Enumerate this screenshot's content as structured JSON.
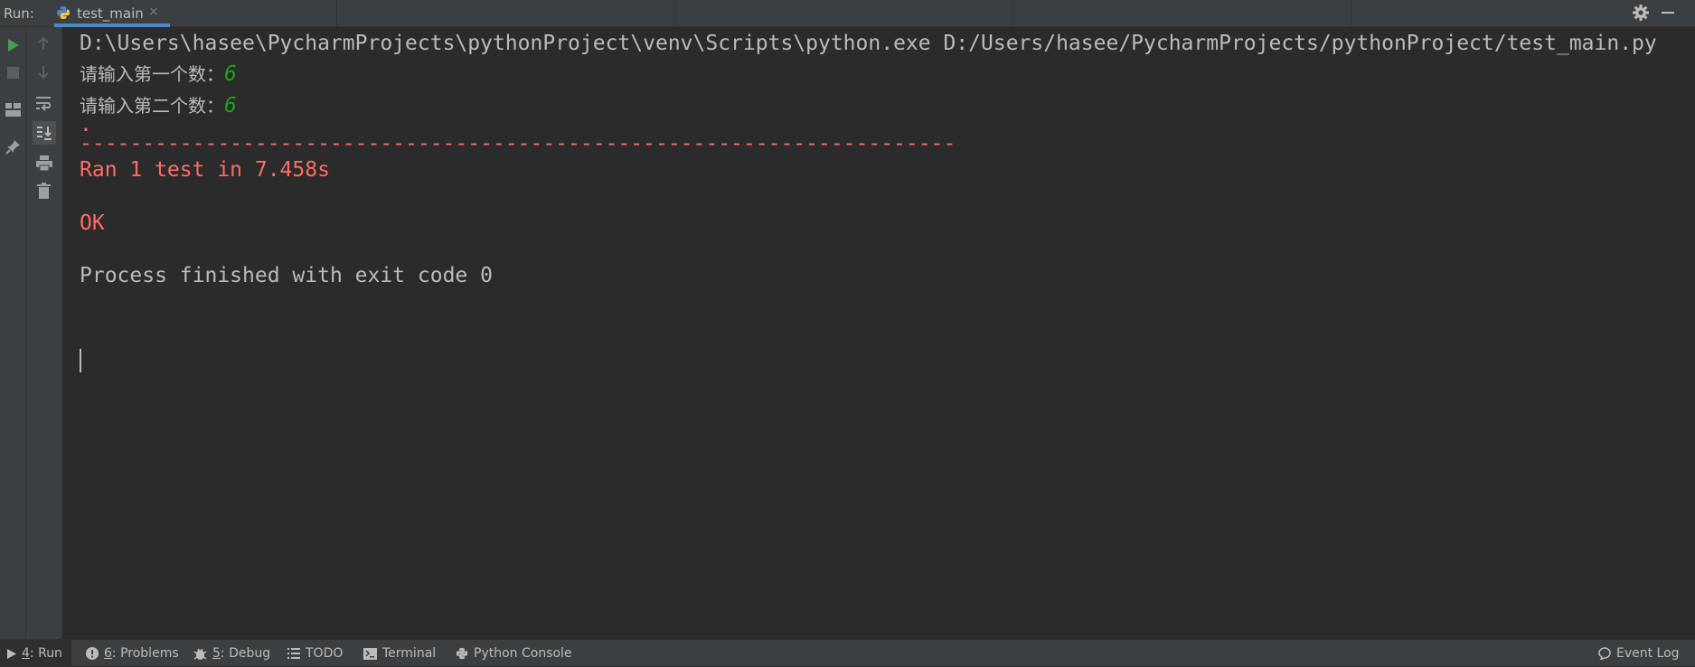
{
  "run_bar": {
    "label": "Run:",
    "tab": {
      "label": "test_main",
      "close": "×"
    }
  },
  "console": {
    "command": "D:\\Users\\hasee\\PycharmProjects\\pythonProject\\venv\\Scripts\\python.exe D:/Users/hasee/PycharmProjects/pythonProject/test_main.py",
    "prompt1": "请输入第一个数：",
    "input1": "6",
    "prompt2": "请输入第二个数：",
    "input2": "6",
    "dot": ".",
    "dashes": "----------------------------------------------------------------------",
    "ran": "Ran 1 test in 7.458s",
    "ok": "OK",
    "finished": "Process finished with exit code 0"
  },
  "bottom_bar": {
    "run": {
      "num": "4",
      "label": ": Run"
    },
    "problems": {
      "num": "6",
      "label": ": Problems"
    },
    "debug": {
      "num": "5",
      "label": ": Debug"
    },
    "todo": "TODO",
    "terminal": "Terminal",
    "python_console": "Python Console",
    "event_log": "Event Log"
  },
  "colors": {
    "background": "#2b2b2b",
    "toolbar": "#3c3f41",
    "accent": "#4a88c7",
    "error_red": "#ff6b68",
    "input_green": "#20a120",
    "run_green": "#499c54"
  },
  "icons": [
    "python-icon",
    "close-icon",
    "gear-icon",
    "minimize-icon",
    "rerun-icon",
    "stop-icon",
    "layout-icon",
    "pin-icon",
    "up-arrow-icon",
    "down-arrow-icon",
    "soft-wrap-icon",
    "scroll-to-end-icon",
    "print-icon",
    "trash-icon",
    "warning-icon",
    "bug-icon",
    "list-icon",
    "terminal-icon",
    "event-log-icon"
  ]
}
